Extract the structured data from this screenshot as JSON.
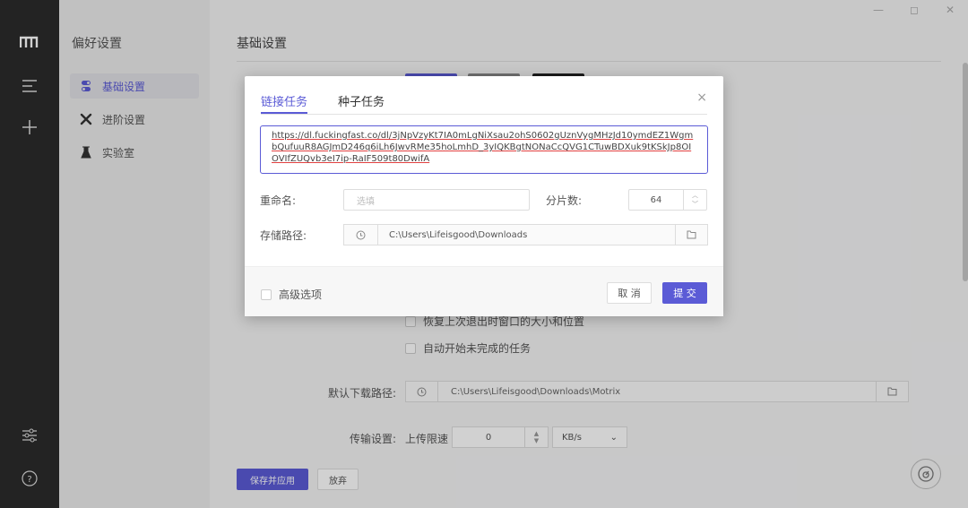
{
  "sidebar": {
    "title": "偏好设置",
    "items": [
      {
        "label": "基础设置",
        "icon": "toggle-icon",
        "active": true
      },
      {
        "label": "进阶设置",
        "icon": "tools-icon",
        "active": false
      },
      {
        "label": "实验室",
        "icon": "flask-icon",
        "active": false
      }
    ]
  },
  "rail": {
    "icons": [
      "logo-icon",
      "menu-icon",
      "plus-icon",
      "sliders-icon",
      "help-icon"
    ]
  },
  "window_controls": [
    "—",
    "◻",
    "✕"
  ],
  "main": {
    "title": "基础设置",
    "restore_window_label": "恢复上次退出时窗口的大小和位置",
    "auto_resume_label": "自动开始未完成的任务",
    "default_path_label": "默认下载路径:",
    "default_path_value": "C:\\Users\\Lifeisgood\\Downloads\\Motrix",
    "transfer_label": "传输设置:",
    "upload_limit_label": "上传限速",
    "upload_limit_value": "0",
    "upload_unit": "KB/s",
    "save_apply_label": "保存并应用",
    "discard_label": "放弃"
  },
  "modal": {
    "tabs": [
      {
        "label": "链接任务",
        "active": true
      },
      {
        "label": "种子任务",
        "active": false
      }
    ],
    "close": "×",
    "url_value": "https://dl.fuckingfast.co/dl/3jNpVzyKt7IA0mLgNiXsau2ohS0602gUznVygMHzJd10ymdEZ1WgmbQufuuR8AGJmD246q6iLh6JwvRMe35hoLmhD_3yIQKBgtNONaCcQVG1CTuwBDXuk9tKSkJp8OIOVIfZUQvb3eI7ip-RaIF509t80DwifA",
    "rename_label": "重命名:",
    "rename_placeholder": "选填",
    "split_label": "分片数:",
    "split_value": "64",
    "dir_label": "存储路径:",
    "dir_value": "C:\\Users\\Lifeisgood\\Downloads",
    "advanced_label": "高级选项",
    "cancel_label": "取 消",
    "submit_label": "提 交"
  },
  "colors": {
    "accent": "#5b5bd6",
    "rail_bg": "#2b2b2b",
    "subnav_bg": "#ececec",
    "main_bg": "#f4f4f5"
  }
}
